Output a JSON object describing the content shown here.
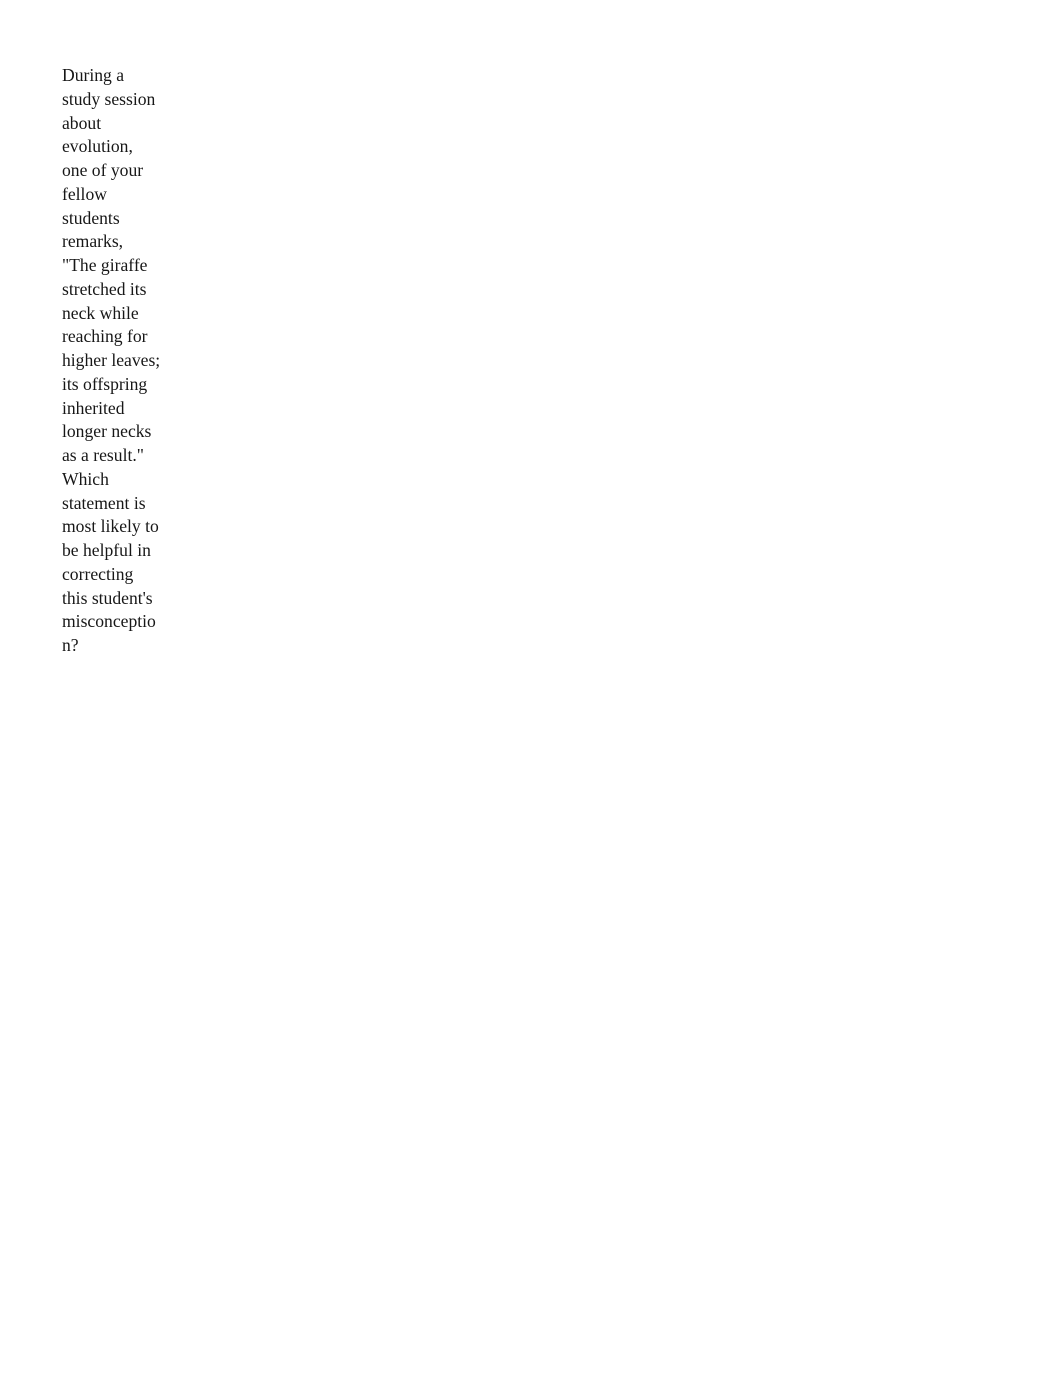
{
  "document": {
    "background_color": "#ffffff",
    "text_color": "#171717",
    "question": {
      "prompt": "During a study session about evolution, one of your fellow students remarks, \"The giraffe stretched its neck while reaching for higher leaves; its offspring inherited longer necks as a result.\" Which statement is most likely to be helpful in correcting this student's misconception?"
    }
  }
}
